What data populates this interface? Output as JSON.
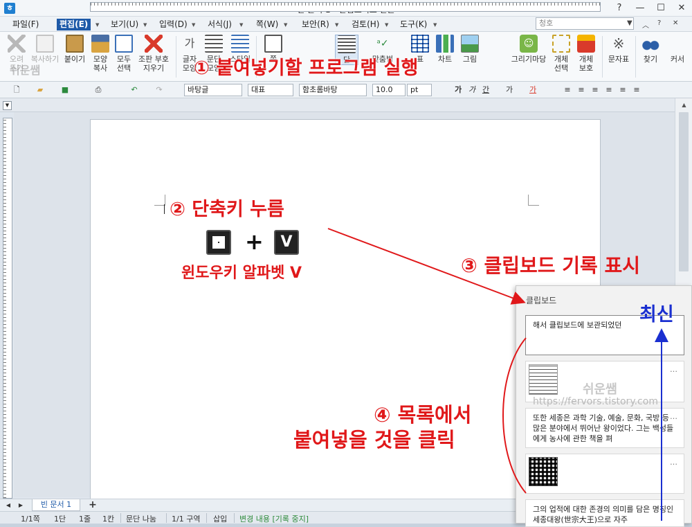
{
  "window": {
    "title": "빈 문서 1 - 한컴오피스 한글",
    "app_icon": "ㅎ",
    "controls": [
      "help-icon",
      "minimize-icon",
      "maximize-icon",
      "close-icon"
    ]
  },
  "menu": {
    "items": [
      "파일(F)",
      "편집(E)",
      "보기(U)",
      "입력(D)",
      "서식(J)",
      "쪽(W)",
      "보안(R)",
      "검토(H)",
      "도구(K)"
    ],
    "active": "편집(E)",
    "style_box": "청호"
  },
  "ribbon": {
    "buttons": [
      {
        "label": "오려\n두기",
        "dim": true,
        "icon": "scissors-icon"
      },
      {
        "label": "복사하기",
        "dim": true,
        "icon": "copy-icon"
      },
      {
        "label": "붙이기",
        "dim": false,
        "icon": "paste-icon"
      },
      {
        "label": "모양\n복사",
        "dim": false,
        "icon": "format-painter-icon"
      },
      {
        "label": "모두\n선택",
        "dim": false,
        "icon": "select-all-icon"
      },
      {
        "label": "조판 부호\n지우기",
        "dim": false,
        "icon": "clear-marks-icon"
      },
      {
        "label": "글자\n모양",
        "dim": false,
        "icon": "char-shape-icon"
      },
      {
        "label": "문단\n모양",
        "dim": false,
        "icon": "para-shape-icon"
      },
      {
        "label": "스타일",
        "dim": false,
        "icon": "style-icon"
      },
      {
        "label": "쪽",
        "dim": false,
        "icon": "page-icon"
      },
      {
        "label": "단",
        "dim": false,
        "icon": "column-icon"
      },
      {
        "label": "맞춤법",
        "dim": false,
        "icon": "spell-icon"
      },
      {
        "label": "표",
        "dim": false,
        "icon": "table-icon"
      },
      {
        "label": "차트",
        "dim": false,
        "icon": "chart-icon"
      },
      {
        "label": "그림",
        "dim": false,
        "icon": "picture-icon"
      },
      {
        "label": "그리기마당",
        "dim": false,
        "icon": "drawing-icon"
      },
      {
        "label": "개체\n선택",
        "dim": false,
        "icon": "object-select-icon"
      },
      {
        "label": "개체\n보호",
        "dim": false,
        "icon": "object-protect-icon"
      },
      {
        "label": "문자표",
        "dim": false,
        "icon": "symbol-icon"
      },
      {
        "label": "찾기",
        "dim": false,
        "icon": "binoculars-icon"
      },
      {
        "label": "커서",
        "dim": false,
        "icon": "cursor-icon"
      }
    ]
  },
  "format_bar": {
    "style": "바탕글",
    "lang": "대표",
    "font": "함초롬바탕",
    "size": "10.0",
    "unit": "pt",
    "char_buttons": [
      "가",
      "가",
      "간",
      "가",
      "가"
    ],
    "align_buttons": [
      "≡",
      "≡",
      "≡",
      "≡",
      "≡",
      "≡"
    ]
  },
  "clipboard": {
    "title": "클립보드",
    "items": [
      {
        "type": "text",
        "text": "해서 클립보드에 보관되었던"
      },
      {
        "type": "image",
        "text": ""
      },
      {
        "type": "text",
        "text": "또한 세종은 과학 기술, 예술, 문화, 국방 등 많은 분야에서 뛰어난 왕이었다. 그는 백성들에게 농사에 관한 책을 펴"
      },
      {
        "type": "qr",
        "text": ""
      },
      {
        "type": "text",
        "text": "그의 업적에 대한 존경의 의미를 담은 명칭인 세종대왕(世宗大王)으로 자주"
      }
    ],
    "more": "…"
  },
  "tabs": {
    "doc_tab": "빈 문서 1",
    "add": "+"
  },
  "status": {
    "page": "1/1쪽",
    "section": "1단",
    "line": "1줄",
    "column": "1칸",
    "break": "문단 나눔",
    "area": "1/1 구역",
    "mode": "삽입",
    "track": "변경 내용 [기록 중지]"
  },
  "annotations": {
    "step1": "① 붙여넣기할 프로그램 실행",
    "step2": "② 단축키 누름",
    "key_win": "win",
    "plus": "+",
    "key_v": "V",
    "key_desc": "윈도우키 알파벳 V",
    "step3": "③ 클립보드 기록 표시",
    "step4_line1": "④ 목록에서",
    "step4_line2": "붙여넣을 것을 클릭",
    "latest": "최신"
  },
  "watermarks": {
    "top": "쉬운쌤",
    "middle": "쉬운쌤",
    "url": "https://fervors.tistory.com"
  },
  "colors": {
    "annotation": "#e0181a",
    "latest": "#1a2fd0",
    "menu_active": "#1e5aa8"
  }
}
